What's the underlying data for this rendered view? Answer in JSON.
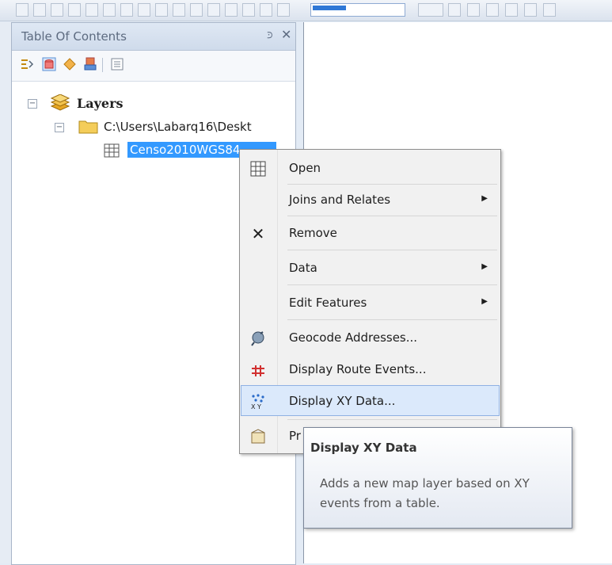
{
  "toc": {
    "title": "Table Of Contents",
    "tree": {
      "root_label": "Layers",
      "folder_label": "C:\\Users\\Labarq16\\Deskt",
      "table_label": "Censo2010WGS84"
    }
  },
  "context_menu": {
    "items": [
      {
        "label": "Open",
        "icon": "table-icon",
        "submenu": false
      },
      {
        "label": "Joins and Relates",
        "icon": null,
        "submenu": true
      },
      {
        "label": "Remove",
        "icon": "remove-icon",
        "submenu": false
      },
      {
        "label": "Data",
        "icon": null,
        "submenu": true
      },
      {
        "label": "Edit Features",
        "icon": null,
        "submenu": true
      },
      {
        "label": "Geocode Addresses...",
        "icon": "geocode-icon",
        "submenu": false
      },
      {
        "label": "Display Route Events...",
        "icon": "route-events-icon",
        "submenu": false
      },
      {
        "label": "Display XY Data...",
        "icon": "xy-data-icon",
        "submenu": false,
        "highlighted": true
      },
      {
        "label": "Pr",
        "icon": "properties-icon",
        "submenu": false
      }
    ]
  },
  "tooltip": {
    "title": "Display XY Data",
    "body": "Adds a new map layer based on XY events from a table."
  },
  "colors": {
    "selection": "#3399ff",
    "menu_highlight": "#dbe9fb",
    "panel_header": "#dfe8f4"
  }
}
